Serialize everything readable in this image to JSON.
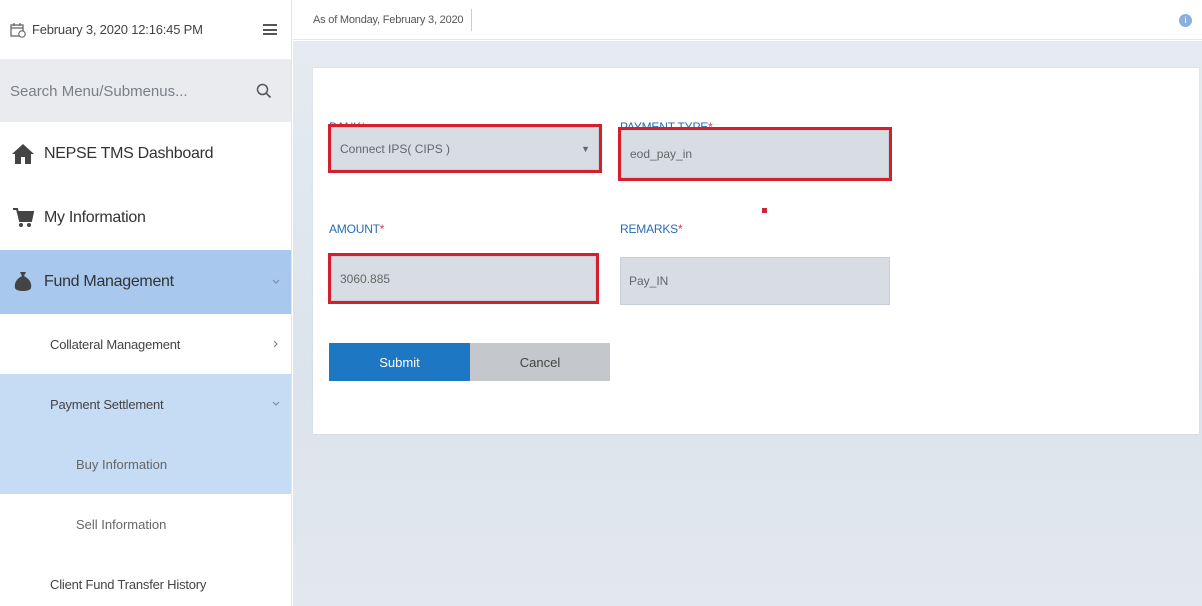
{
  "sidebar": {
    "datetime": "February 3, 2020 12:16:45 PM",
    "search_placeholder": "Search Menu/Submenus...",
    "items": [
      {
        "label": "NEPSE TMS Dashboard"
      },
      {
        "label": "My Information"
      },
      {
        "label": "Fund Management"
      }
    ],
    "subitems": [
      {
        "label": "Collateral Management"
      },
      {
        "label": "Payment Settlement"
      }
    ],
    "subsubitems": [
      {
        "label": "Buy Information"
      },
      {
        "label": "Sell Information"
      }
    ],
    "history": {
      "label": "Client Fund Transfer History"
    }
  },
  "topbar": {
    "asof": "As of Monday, February 3, 2020"
  },
  "form": {
    "bank_label": "BANK",
    "bank_value": "Connect IPS( CIPS )",
    "payment_type_label": "PAYMENT TYPE",
    "payment_type_value": "eod_pay_in",
    "amount_label": "AMOUNT",
    "amount_value": "3060.885",
    "remarks_label": "REMARKS",
    "remarks_value": "Pay_IN",
    "required_mark": "*",
    "submit_label": "Submit",
    "cancel_label": "Cancel"
  },
  "colors": {
    "accent": "#1d77c2",
    "highlight": "#d4202e",
    "label": "#2a6db5",
    "active_nav": "#a9c8ee"
  }
}
